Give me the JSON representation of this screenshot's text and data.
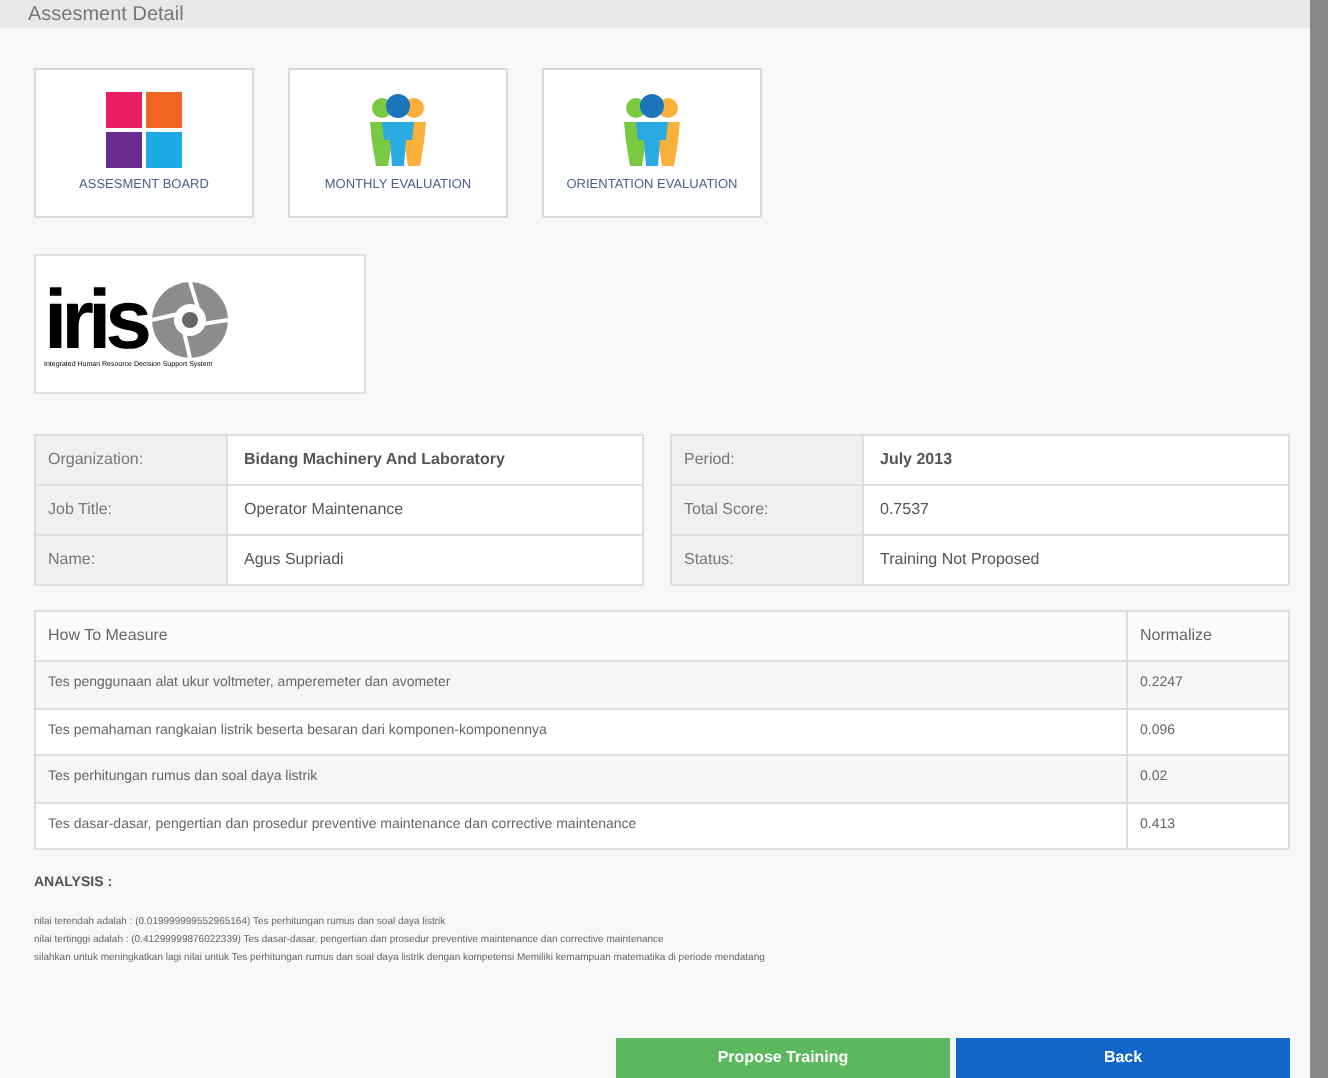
{
  "header": {
    "title": "Assesment Detail"
  },
  "menu_cards": [
    {
      "label": "ASSESMENT BOARD",
      "kind": "grid"
    },
    {
      "label": "MONTHLY EVALUATION",
      "kind": "people"
    },
    {
      "label": "ORIENTATION EVALUATION",
      "kind": "people"
    }
  ],
  "logo": {
    "name": "iris",
    "tagline": "Integrated Human Resource Decision Support System"
  },
  "info_left": [
    {
      "label": "Organization:",
      "value": "Bidang Machinery And Laboratory",
      "bold": true
    },
    {
      "label": "Job Title:",
      "value": "Operator Maintenance",
      "bold": false
    },
    {
      "label": "Name:",
      "value": "Agus Supriadi",
      "bold": false
    }
  ],
  "info_right": [
    {
      "label": "Period:",
      "value": "July 2013",
      "bold": true
    },
    {
      "label": "Total Score:",
      "value": "0.7537",
      "bold": false
    },
    {
      "label": "Status:",
      "value": "Training Not Proposed",
      "bold": false
    }
  ],
  "measure_table": {
    "columns": [
      "How To Measure",
      "Normalize"
    ],
    "rows": [
      [
        "Tes penggunaan alat ukur voltmeter, amperemeter dan avometer",
        "0.2247"
      ],
      [
        "Tes pemahaman rangkaian listrik beserta besaran dari komponen-komponennya",
        "0.096"
      ],
      [
        "Tes perhitungan rumus dan soal daya listrik",
        "0.02"
      ],
      [
        "Tes dasar-dasar, pengertian dan prosedur preventive maintenance dan corrective maintenance",
        "0.413"
      ]
    ]
  },
  "analysis": {
    "heading": "ANALYSIS :",
    "lines": [
      "nilai terendah adalah : (0.019999999552965164) Tes perhitungan rumus dan soal daya listrik",
      "nilai tertinggi adalah : (0.41299999876022339) Tes dasar-dasar, pengertian dan prosedur preventive maintenance dan corrective maintenance",
      "silahkan untuk meningkatkan lagi nilai untuk Tes perhitungan rumus dan soal daya listrik dengan kompetensi Memiliki kemampuan matematika di periode mendatang"
    ]
  },
  "buttons": [
    {
      "label": "Propose Training",
      "kind": "primary"
    },
    {
      "label": "Back",
      "kind": "secondary"
    }
  ]
}
